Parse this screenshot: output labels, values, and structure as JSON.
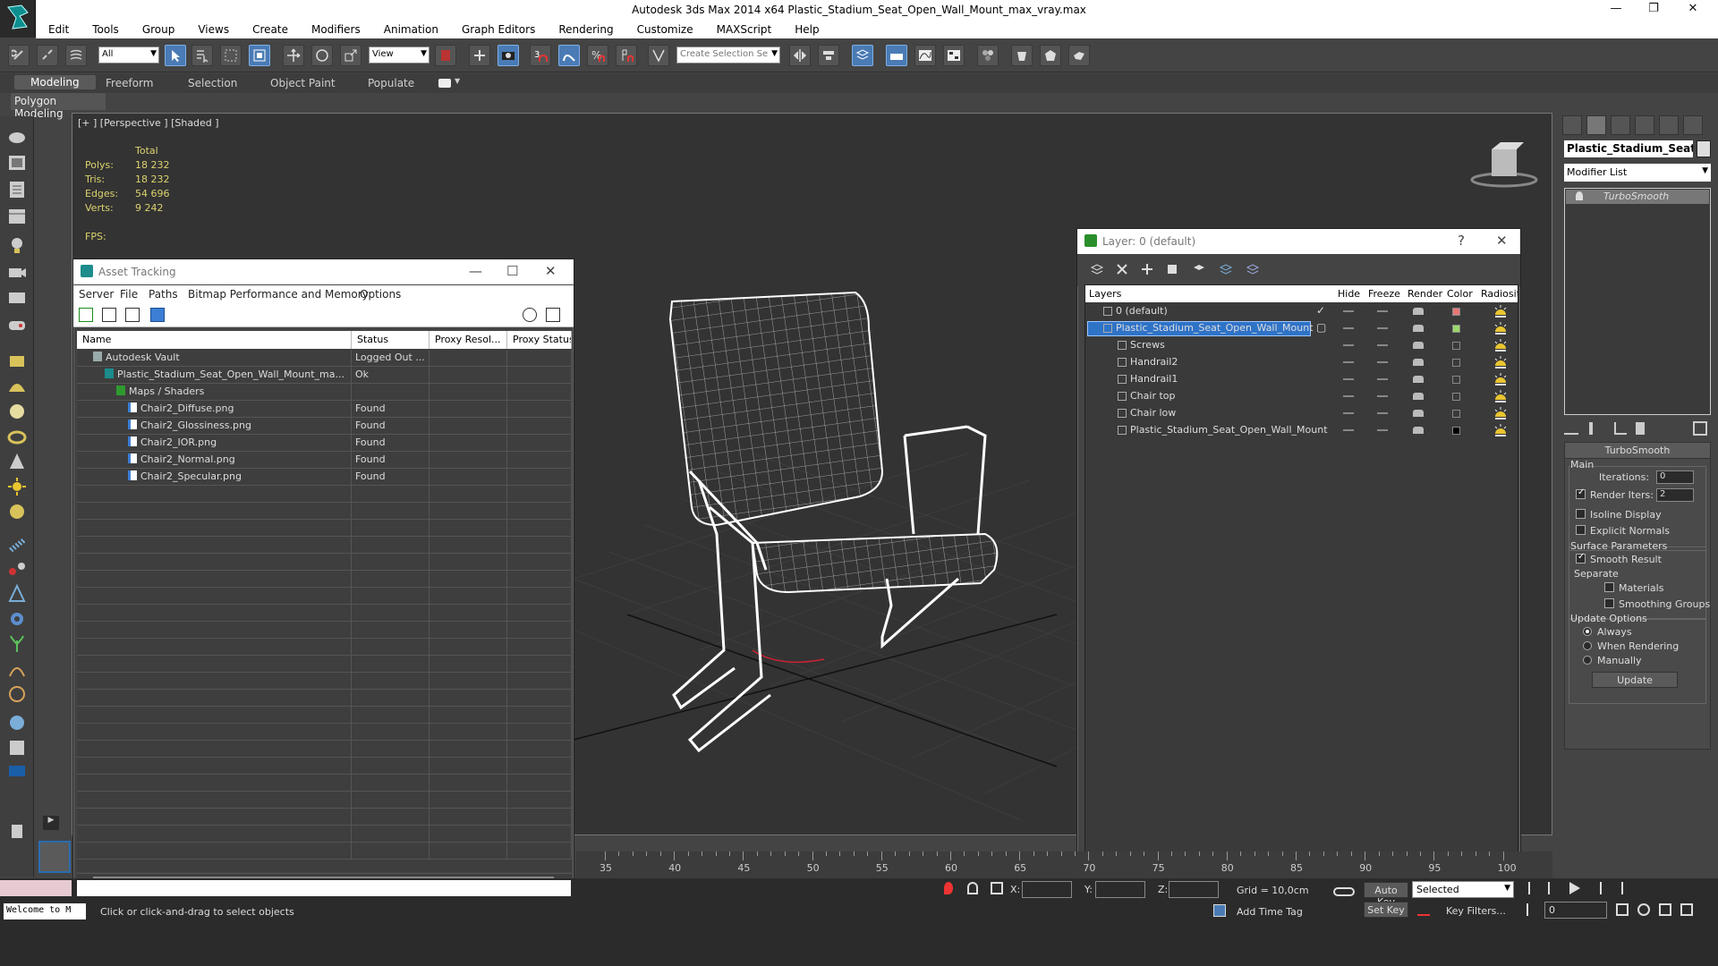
{
  "window": {
    "title": "Autodesk 3ds Max  2014 x64    Plastic_Stadium_Seat_Open_Wall_Mount_max_vray.max"
  },
  "menu": [
    "Edit",
    "Tools",
    "Group",
    "Views",
    "Create",
    "Modifiers",
    "Animation",
    "Graph Editors",
    "Rendering",
    "Customize",
    "MAXScript",
    "Help"
  ],
  "toolbar": {
    "filter_value": "All",
    "refcoord_value": "View",
    "selset_placeholder": "Create Selection Se",
    "snap_number": "3"
  },
  "ribbon": {
    "tabs": [
      "Modeling",
      "Freeform",
      "Selection",
      "Object Paint",
      "Populate"
    ],
    "sub": "Polygon Modeling"
  },
  "viewport": {
    "label": "[+ ] [Perspective ] [Shaded ]",
    "stats_header": "Total",
    "stats": [
      {
        "k": "Polys:",
        "v": "18 232"
      },
      {
        "k": "Tris:",
        "v": "18 232"
      },
      {
        "k": "Edges:",
        "v": "54 696"
      },
      {
        "k": "Verts:",
        "v": "9 242"
      }
    ],
    "fps": "FPS:"
  },
  "asset": {
    "title": "Asset Tracking",
    "menu": [
      "Server",
      "File",
      "Paths",
      "Bitmap Performance and Memory",
      "Options"
    ],
    "columns": [
      "Name",
      "Status",
      "Proxy Resol...",
      "Proxy Status"
    ],
    "rows": [
      {
        "name": "Autodesk Vault",
        "status": "Logged Out ...",
        "indent": 0,
        "icon": "vault"
      },
      {
        "name": "Plastic_Stadium_Seat_Open_Wall_Mount_ma...",
        "status": "Ok",
        "indent": 1,
        "icon": "max"
      },
      {
        "name": "Maps / Shaders",
        "status": "",
        "indent": 2,
        "icon": "maps"
      },
      {
        "name": "Chair2_Diffuse.png",
        "status": "Found",
        "indent": 3,
        "icon": "file"
      },
      {
        "name": "Chair2_Glossiness.png",
        "status": "Found",
        "indent": 3,
        "icon": "file"
      },
      {
        "name": "Chair2_IOR.png",
        "status": "Found",
        "indent": 3,
        "icon": "file"
      },
      {
        "name": "Chair2_Normal.png",
        "status": "Found",
        "indent": 3,
        "icon": "file"
      },
      {
        "name": "Chair2_Specular.png",
        "status": "Found",
        "indent": 3,
        "icon": "file"
      }
    ]
  },
  "layer": {
    "title": "Layer: 0 (default)",
    "columns": [
      "Layers",
      "Hide",
      "Freeze",
      "Render",
      "Color",
      "Radiosit"
    ],
    "rows": [
      {
        "name": "0 (default)",
        "indent": 0,
        "color": "#e87878",
        "check": true
      },
      {
        "name": "Plastic_Stadium_Seat_Open_Wall_Mount",
        "indent": 0,
        "color": "#9bd86b",
        "selected": true
      },
      {
        "name": "Screws",
        "indent": 1,
        "color": ""
      },
      {
        "name": "Handrail2",
        "indent": 1,
        "color": ""
      },
      {
        "name": "Handrail1",
        "indent": 1,
        "color": ""
      },
      {
        "name": "Chair top",
        "indent": 1,
        "color": ""
      },
      {
        "name": "Chair low",
        "indent": 1,
        "color": ""
      },
      {
        "name": "Plastic_Stadium_Seat_Open_Wall_Mount",
        "indent": 1,
        "color": "#000000"
      }
    ]
  },
  "command": {
    "object_name": "Plastic_Stadium_Seat_O",
    "modifier_list": "Modifier List",
    "stack_item": "TurboSmooth",
    "rollout_title": "TurboSmooth",
    "main": "Main",
    "iterations_label": "Iterations:",
    "iterations_value": "0",
    "render_iters_label": "Render Iters:",
    "render_iters_value": "2",
    "isoline": "Isoline Display",
    "explicit": "Explicit Normals",
    "surface": "Surface Parameters",
    "smooth_result": "Smooth Result",
    "separate": "Separate",
    "materials": "Materials",
    "smoothing_groups": "Smoothing Groups",
    "update_options": "Update Options",
    "always": "Always",
    "when_rendering": "When Rendering",
    "manually": "Manually",
    "update": "Update"
  },
  "timeline": {
    "numbers": [
      "35",
      "40",
      "45",
      "50",
      "55",
      "60",
      "65",
      "70",
      "75",
      "80",
      "85",
      "90",
      "95",
      "100"
    ]
  },
  "bottom": {
    "x_label": "X:",
    "y_label": "Y:",
    "z_label": "Z:",
    "grid": "Grid = 10,0cm",
    "autokey": "Auto Key",
    "selected": "Selected",
    "setkey": "Set Key",
    "keyfilters": "Key Filters...",
    "frame": "0",
    "welcome": "Welcome to M",
    "prompt": "Click or click-and-drag to select objects",
    "addtimetag": "Add Time Tag"
  }
}
